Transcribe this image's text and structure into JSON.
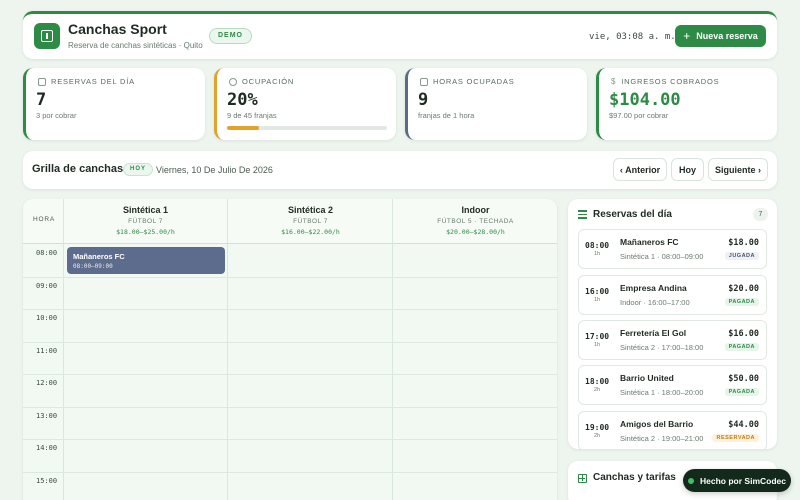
{
  "header": {
    "title": "Canchas Sport",
    "subtitle": "Reserva de canchas sintéticas · Quito",
    "badge": "DEMO",
    "clock": "vie, 03:08 a. m.",
    "new_button": "Nueva reserva"
  },
  "stats": [
    {
      "label": "RESERVAS DEL DÍA",
      "value": "7",
      "sub": "3 por cobrar",
      "icon": "calendar-icon"
    },
    {
      "label": "OCUPACIÓN",
      "value": "20%",
      "sub": "9 de 45 franjas",
      "icon": "clock-icon",
      "progress": 0.2
    },
    {
      "label": "HORAS OCUPADAS",
      "value": "9",
      "sub": "franjas de 1 hora",
      "icon": "calendar-icon"
    },
    {
      "label": "INGRESOS COBRADOS",
      "value": "$104.00",
      "sub": "$97.00 por cobrar",
      "icon": "dollar-icon"
    }
  ],
  "grid": {
    "title": "Grilla de canchas",
    "today_badge": "HOY",
    "date": "Viernes, 10 De Julio De 2026",
    "prev": "‹ Anterior",
    "today": "Hoy",
    "next": "Siguiente ›",
    "hora_label": "HORA",
    "courts": [
      {
        "name": "Sintética 1",
        "type": "FÚTBOL 7",
        "rate": "$18.00–$25.00/h"
      },
      {
        "name": "Sintética 2",
        "type": "FÚTBOL 7",
        "rate": "$16.00–$22.00/h"
      },
      {
        "name": "Indoor",
        "type": "FÚTBOL 5 · TECHADA",
        "rate": "$20.00–$28.00/h"
      }
    ],
    "hours": [
      "08:00",
      "09:00",
      "10:00",
      "11:00",
      "12:00",
      "13:00",
      "14:00",
      "15:00"
    ],
    "slots": [
      {
        "name": "Mañaneros FC",
        "time": "08:00–09:00",
        "court": 0
      }
    ]
  },
  "reservations": {
    "title": "Reservas del día",
    "count": "7",
    "items": [
      {
        "time": "08:00",
        "dur": "1h",
        "name": "Mañaneros FC",
        "detail": "Sintética 1 · 08:00–09:00",
        "price": "$18.00",
        "status": "JUGADA",
        "status_color": "#4b5570"
      },
      {
        "time": "16:00",
        "dur": "1h",
        "name": "Empresa Andina",
        "detail": "Indoor · 16:00–17:00",
        "price": "$20.00",
        "status": "PAGADA",
        "status_color": "#2e8b46"
      },
      {
        "time": "17:00",
        "dur": "1h",
        "name": "Ferretería El Gol",
        "detail": "Sintética 2 · 17:00–18:00",
        "price": "$16.00",
        "status": "PAGADA",
        "status_color": "#2e8b46"
      },
      {
        "time": "18:00",
        "dur": "2h",
        "name": "Barrio United",
        "detail": "Sintética 1 · 18:00–20:00",
        "price": "$50.00",
        "status": "PAGADA",
        "status_color": "#2e8b46"
      },
      {
        "time": "19:00",
        "dur": "2h",
        "name": "Amigos del Barrio",
        "detail": "Sintética 2 · 19:00–21:00",
        "price": "$44.00",
        "status": "RESERVADA",
        "status_color": "#c47d10"
      }
    ]
  },
  "tariffs": {
    "title": "Canchas y tarifas"
  },
  "footer": {
    "made_by": "Hecho por SimCodec"
  },
  "colors": {
    "brand": "#2e8b46",
    "slot": "#5d6c8d",
    "warning": "#e0a42a",
    "background": "#eef5ef"
  }
}
